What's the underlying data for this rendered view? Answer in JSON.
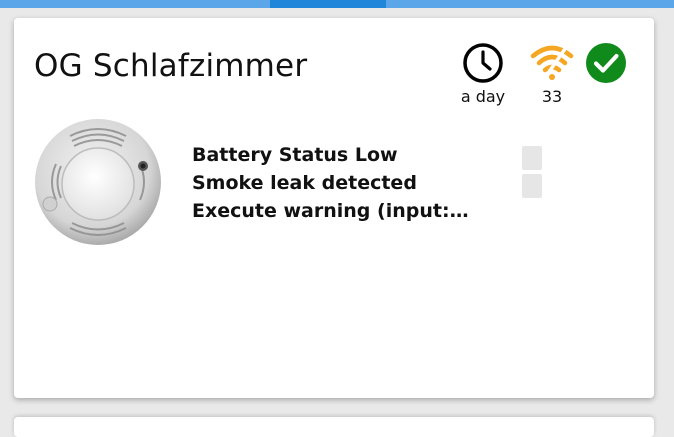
{
  "card": {
    "title": "OG Schlafzimmer",
    "status": {
      "last_seen": {
        "icon": "clock-icon",
        "label": "a day"
      },
      "link_quality": {
        "icon": "wifi-icon",
        "label": "33",
        "color": "#f5a623"
      },
      "availability": {
        "icon": "check-circle-icon",
        "color": "#118a1c"
      }
    },
    "image": {
      "icon": "smoke-detector-image"
    },
    "exposes": [
      {
        "label": "Battery Status Low"
      },
      {
        "label": "Smoke leak detected"
      },
      {
        "label": "Execute warning (input: ..."
      }
    ]
  }
}
